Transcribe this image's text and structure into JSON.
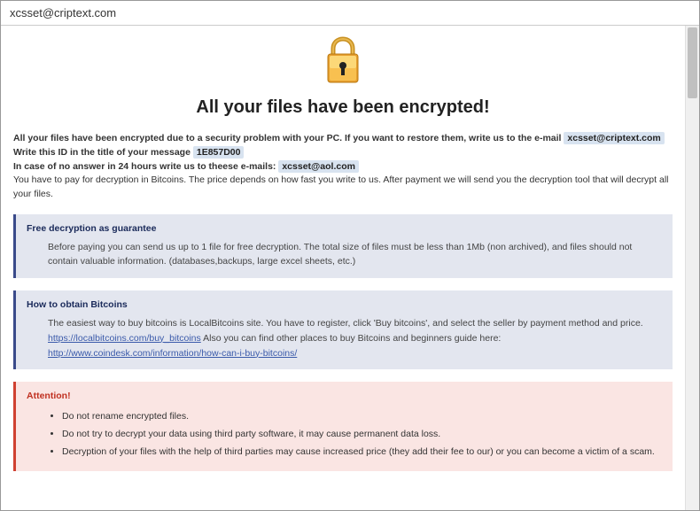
{
  "window": {
    "title": "xcsset@criptext.com"
  },
  "header": {
    "main_title": "All your files have been encrypted!"
  },
  "intro": {
    "line1_a": "All your files have been encrypted due to a security problem with your PC. If you want to restore them, write us to the e-mail",
    "email1": "xcsset@criptext.com",
    "line2_a": "Write this ID in the title of your message",
    "id_value": "1E857D00",
    "line3_a": "In case of no answer in 24 hours write us to theese e-mails:",
    "email2": "xcsset@aol.com",
    "line4": "You have to pay for decryption in Bitcoins. The price depends on how fast you write to us. After payment we will send you the decryption tool that will decrypt all your files."
  },
  "guarantee": {
    "title": "Free decryption as guarantee",
    "body": "Before paying you can send us up to 1 file for free decryption. The total size of files must be less than 1Mb (non archived), and files should not contain valuable information. (databases,backups, large excel sheets, etc.)"
  },
  "bitcoins": {
    "title": "How to obtain Bitcoins",
    "line1": "The easiest way to buy bitcoins is LocalBitcoins site. You have to register, click 'Buy bitcoins', and select the seller by payment method and price.",
    "link1": "https://localbitcoins.com/buy_bitcoins",
    "line2": "Also you can find other places to buy Bitcoins and beginners guide here:",
    "link2": "http://www.coindesk.com/information/how-can-i-buy-bitcoins/"
  },
  "attention": {
    "title": "Attention!",
    "items": [
      "Do not rename encrypted files.",
      "Do not try to decrypt your data using third party software, it may cause permanent data loss.",
      "Decryption of your files with the help of third parties may cause increased price (they add their fee to our) or you can become a victim of a scam."
    ]
  }
}
